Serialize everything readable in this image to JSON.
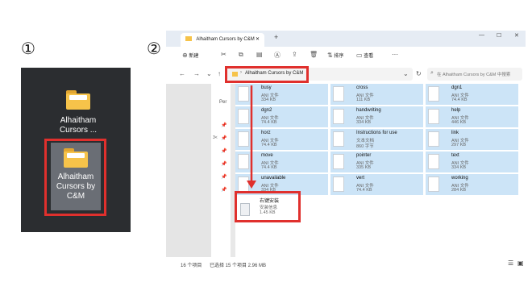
{
  "steps": {
    "one": "①",
    "two": "②"
  },
  "desktop": {
    "folder1_label": "Alhaitham\nCursors ...",
    "folder2_label": "Alhaitham\nCursors by\nC&M"
  },
  "explorer": {
    "tab_title": "Alhaitham Cursors by C&M",
    "new_tab": "+",
    "win_min": "—",
    "win_max": "☐",
    "win_close": "✕",
    "toolbar": {
      "new_label": "新建",
      "sort_label": "排序",
      "view_label": "查看",
      "more": "···"
    },
    "address": "Alhaitham Cursors by C&M",
    "search_placeholder": "在 Alhaitham Cursors by C&M 中搜索",
    "nav_label": "Per",
    "files": [
      {
        "name": "busy",
        "type": "ANI 文件",
        "size": "334 KB"
      },
      {
        "name": "cross",
        "type": "ANI 文件",
        "size": "111 KB"
      },
      {
        "name": "dgn1",
        "type": "ANI 文件",
        "size": "74.4 KB"
      },
      {
        "name": "dgn2",
        "type": "ANI 文件",
        "size": "74.4 KB"
      },
      {
        "name": "handwriting",
        "type": "ANI 文件",
        "size": "334 KB"
      },
      {
        "name": "help",
        "type": "ANI 文件",
        "size": "446 KB"
      },
      {
        "name": "horz",
        "type": "ANI 文件",
        "size": "74.4 KB"
      },
      {
        "name": "Instructions for use",
        "type": "文本文档",
        "size": "860 字节"
      },
      {
        "name": "link",
        "type": "ANI 文件",
        "size": "297 KB"
      },
      {
        "name": "move",
        "type": "ANI 文件",
        "size": "74.4 KB"
      },
      {
        "name": "pointer",
        "type": "ANI 文件",
        "size": "335 KB"
      },
      {
        "name": "text",
        "type": "ANI 文件",
        "size": "334 KB"
      },
      {
        "name": "unavailable",
        "type": "ANI 文件",
        "size": "334 KB"
      },
      {
        "name": "vert",
        "type": "ANI 文件",
        "size": "74.4 KB"
      },
      {
        "name": "working",
        "type": "ANI 文件",
        "size": "284 KB"
      }
    ],
    "installer": {
      "name": "右键安装",
      "type": "安装信息",
      "size": "1.45 KB"
    },
    "status": {
      "count": "16 个项目",
      "selected": "已选择 15 个项目 2.96 MB"
    }
  },
  "colors": {
    "highlight": "#e0302d",
    "selection": "#cce4f7"
  }
}
